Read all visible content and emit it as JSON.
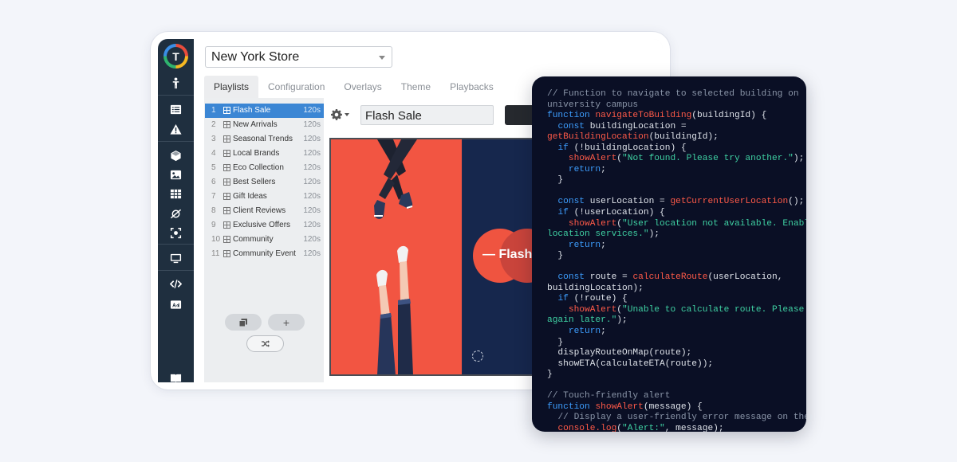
{
  "app": {
    "logo_letter": "T",
    "store": "New York Store",
    "tabs": [
      "Playlists",
      "Configuration",
      "Overlays",
      "Theme",
      "Playbacks"
    ],
    "active_tab": "Playlists",
    "playlists": [
      {
        "num": "1",
        "name": "Flash Sale",
        "duration": "120s"
      },
      {
        "num": "2",
        "name": "New Arrivals",
        "duration": "120s"
      },
      {
        "num": "3",
        "name": "Seasonal Trends",
        "duration": "120s"
      },
      {
        "num": "4",
        "name": "Local Brands",
        "duration": "120s"
      },
      {
        "num": "5",
        "name": "Eco Collection",
        "duration": "120s"
      },
      {
        "num": "6",
        "name": "Best Sellers",
        "duration": "120s"
      },
      {
        "num": "7",
        "name": "Gift Ideas",
        "duration": "120s"
      },
      {
        "num": "8",
        "name": "Client Reviews",
        "duration": "120s"
      },
      {
        "num": "9",
        "name": "Exclusive Offers",
        "duration": "120s"
      },
      {
        "num": "10",
        "name": "Community",
        "duration": "120s"
      },
      {
        "num": "11",
        "name": "Community Event",
        "duration": "120s"
      }
    ],
    "selected_playlist": "Flash Sale",
    "add_button_label": "+",
    "playlist_name_value": "Flash Sale",
    "preview_text": "— Flash",
    "sidebar_icons": [
      "person-icon",
      "list-icon",
      "alert-icon",
      "cube-icon",
      "image-icon",
      "grid-icon",
      "planet-icon",
      "scan-icon",
      "monitor-icon",
      "code-icon",
      "ad-icon",
      "book-icon"
    ]
  },
  "code": {
    "lines": [
      [
        [
          "cm",
          "// Function to navigate to selected building on"
        ]
      ],
      [
        [
          "cm",
          "university campus"
        ]
      ],
      [
        [
          "kw",
          "function "
        ],
        [
          "fn",
          "navigateToBuilding"
        ],
        [
          "tx",
          "(buildingId) {"
        ]
      ],
      [
        [
          "tx",
          "  "
        ],
        [
          "kw",
          "const "
        ],
        [
          "tx",
          "buildingLocation ="
        ]
      ],
      [
        [
          "fn",
          "getBuildingLocation"
        ],
        [
          "tx",
          "(buildingId);"
        ]
      ],
      [
        [
          "tx",
          "  "
        ],
        [
          "kw",
          "if "
        ],
        [
          "tx",
          "(!buildingLocation) {"
        ]
      ],
      [
        [
          "tx",
          "    "
        ],
        [
          "fn",
          "showAlert"
        ],
        [
          "tx",
          "("
        ],
        [
          "st",
          "\"Not found. Please try another.\""
        ],
        [
          "tx",
          ");"
        ]
      ],
      [
        [
          "tx",
          "    "
        ],
        [
          "kw",
          "return"
        ],
        [
          "tx",
          ";"
        ]
      ],
      [
        [
          "tx",
          "  }"
        ]
      ],
      [
        [
          "tx",
          ""
        ]
      ],
      [
        [
          "tx",
          "  "
        ],
        [
          "kw",
          "const "
        ],
        [
          "tx",
          "userLocation = "
        ],
        [
          "fn",
          "getCurrentUserLocation"
        ],
        [
          "tx",
          "();"
        ]
      ],
      [
        [
          "tx",
          "  "
        ],
        [
          "kw",
          "if "
        ],
        [
          "tx",
          "(!userLocation) {"
        ]
      ],
      [
        [
          "tx",
          "    "
        ],
        [
          "fn",
          "showAlert"
        ],
        [
          "tx",
          "("
        ],
        [
          "st",
          "\"User location not available. Enable"
        ]
      ],
      [
        [
          "st",
          "location services.\""
        ],
        [
          "tx",
          ");"
        ]
      ],
      [
        [
          "tx",
          "    "
        ],
        [
          "kw",
          "return"
        ],
        [
          "tx",
          ";"
        ]
      ],
      [
        [
          "tx",
          "  }"
        ]
      ],
      [
        [
          "tx",
          ""
        ]
      ],
      [
        [
          "tx",
          "  "
        ],
        [
          "kw",
          "const "
        ],
        [
          "tx",
          "route = "
        ],
        [
          "fn",
          "calculateRoute"
        ],
        [
          "tx",
          "(userLocation,"
        ]
      ],
      [
        [
          "tx",
          "buildingLocation);"
        ]
      ],
      [
        [
          "tx",
          "  "
        ],
        [
          "kw",
          "if "
        ],
        [
          "tx",
          "(!route) {"
        ]
      ],
      [
        [
          "tx",
          "    "
        ],
        [
          "fn",
          "showAlert"
        ],
        [
          "tx",
          "("
        ],
        [
          "st",
          "\"Unable to calculate route. Please try"
        ]
      ],
      [
        [
          "st",
          "again later.\""
        ],
        [
          "tx",
          ");"
        ]
      ],
      [
        [
          "tx",
          "    "
        ],
        [
          "kw",
          "return"
        ],
        [
          "tx",
          ";"
        ]
      ],
      [
        [
          "tx",
          "  }"
        ]
      ],
      [
        [
          "tx",
          "  displayRouteOnMap(route);"
        ]
      ],
      [
        [
          "tx",
          "  showETA(calculateETA(route));"
        ]
      ],
      [
        [
          "tx",
          "}"
        ]
      ],
      [
        [
          "tx",
          ""
        ]
      ],
      [
        [
          "cm",
          "// Touch-friendly alert"
        ]
      ],
      [
        [
          "kw",
          "function "
        ],
        [
          "fn",
          "showAlert"
        ],
        [
          "tx",
          "(message) {"
        ]
      ],
      [
        [
          "tx",
          "  "
        ],
        [
          "cm",
          "// Display a user-friendly error message on the"
        ]
      ],
      [
        [
          "tx",
          "  "
        ],
        [
          "fn",
          "console.log"
        ],
        [
          "tx",
          "("
        ],
        [
          "st",
          "\"Alert:\""
        ],
        [
          "tx",
          ", message);"
        ]
      ]
    ]
  },
  "colors": {
    "sidebar": "#1f2f3f",
    "selection": "#3b86d4",
    "code_bg": "#0a0f25",
    "keyword": "#3d9dfd",
    "function": "#ff5a48",
    "string": "#3fd1a3",
    "comment": "#8a95a8",
    "preview_red": "#f25542",
    "preview_navy": "#16274d"
  }
}
